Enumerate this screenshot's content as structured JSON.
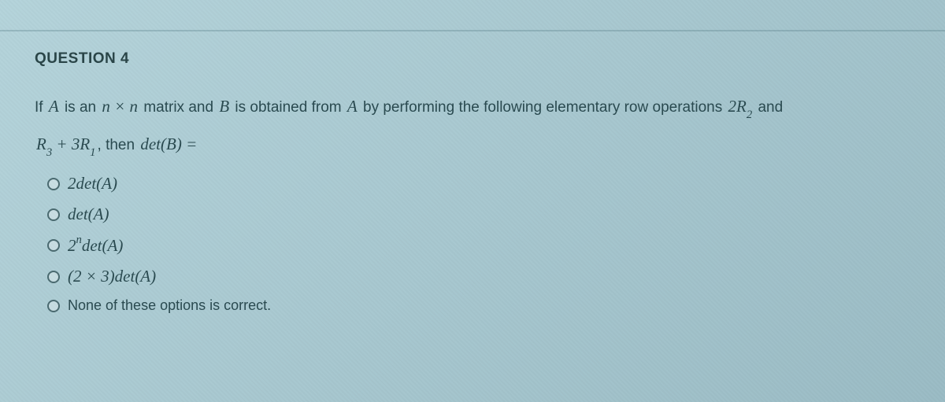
{
  "question": {
    "title": "QUESTION 4",
    "text_parts": {
      "p1": "If ",
      "A": "A",
      "p2": " is an ",
      "nxn": "n × n",
      "p3": " matrix and ",
      "B": "B",
      "p4": " is obtained from ",
      "A2": "A",
      "p5": " by performing the following elementary row operations ",
      "op1": "2R",
      "op1sub": "2",
      "p6": " and",
      "op2a": "R",
      "op2asub": "3",
      "op2mid": " + 3R",
      "op2bsub": "1",
      "p7": ", then ",
      "det": "det(B) =",
      "comma": ""
    },
    "options": [
      {
        "label": "2det(A)"
      },
      {
        "label": "det(A)"
      },
      {
        "label_pre": "2",
        "label_sup": "n",
        "label_post": "det(A)"
      },
      {
        "label": "(2 × 3)det(A)"
      },
      {
        "label_plain": "None of these options is correct."
      }
    ]
  }
}
